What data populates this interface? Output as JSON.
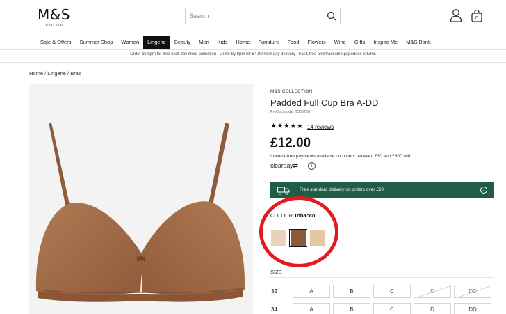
{
  "header": {
    "logo": "M&S",
    "logo_sub": "EST. 1884",
    "search_placeholder": "Search"
  },
  "nav": {
    "items": [
      "Sale & Offers",
      "Summer Shop",
      "Women",
      "Lingerie",
      "Beauty",
      "Men",
      "Kids",
      "Home",
      "Furniture",
      "Food",
      "Flowers",
      "Wine",
      "Gifts",
      "Inspire Me",
      "M&S Bank"
    ],
    "active": "Lingerie"
  },
  "promo_bar": "Order by 8pm for free next-day store collection  |  Order by 8pm for £4.99 next-day delivery  |  Fast, free and trackable paperless returns",
  "breadcrumb": "Home / Lingerie / Bras",
  "product": {
    "brand": "M&S COLLECTION",
    "title": "Padded Full Cup Bra A-DD",
    "code": "Product code: T330293",
    "stars": "★★★★★",
    "reviews": "14 reviews",
    "price": "£12.00",
    "clearpay_text": "Interest-free payments available on orders between £30 and £800 with",
    "clearpay_logo": "clearpay",
    "delivery": "Free standard delivery on orders over £50",
    "colour_label": "COLOUR",
    "colour_value": "Tobacco",
    "swatches": [
      {
        "name": "light beige",
        "color": "#e8d2bb"
      },
      {
        "name": "Tobacco",
        "color": "#8a5a3c"
      },
      {
        "name": "nude",
        "color": "#e6c7a4"
      }
    ],
    "size_label": "SIZE",
    "size_rows": [
      {
        "band": "32",
        "cups": [
          "A",
          "B",
          "C",
          "D",
          "DD"
        ],
        "available": [
          true,
          true,
          true,
          false,
          false
        ]
      },
      {
        "band": "34",
        "cups": [
          "A",
          "B",
          "C",
          "D",
          "DD"
        ],
        "available": [
          true,
          true,
          true,
          true,
          true
        ]
      }
    ]
  },
  "colors": {
    "accent_green": "#1f5e45",
    "annotation_red": "#e21c1c",
    "product_tone": "#a8714c"
  }
}
